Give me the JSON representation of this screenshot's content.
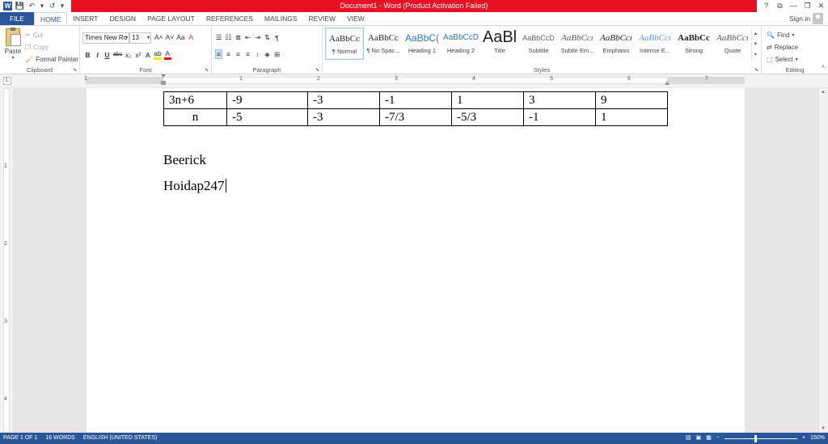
{
  "window": {
    "title": "Document1 -  Word (Product Activation Failed)",
    "controls": {
      "help": "?",
      "ribbon_options": "⧉",
      "minimize": "—",
      "restore": "❐",
      "close": "✕"
    }
  },
  "qat": {
    "logo": "W",
    "save": "💾",
    "undo": "↶",
    "undo_arrow": "▾",
    "redo": "↺",
    "more": "▾"
  },
  "tabs": [
    {
      "label": "FILE"
    },
    {
      "label": "HOME"
    },
    {
      "label": "INSERT"
    },
    {
      "label": "DESIGN"
    },
    {
      "label": "PAGE LAYOUT"
    },
    {
      "label": "REFERENCES"
    },
    {
      "label": "MAILINGS"
    },
    {
      "label": "REVIEW"
    },
    {
      "label": "VIEW"
    }
  ],
  "signin": {
    "label": "Sign in"
  },
  "clipboard": {
    "group_label": "Clipboard",
    "paste_label": "Paste",
    "cut_label": "Cut",
    "copy_label": "Copy",
    "format_painter_label": "Format Painter"
  },
  "font": {
    "group_label": "Font",
    "font_name": "Times New Ro",
    "font_size": "13",
    "grow": "A˄",
    "shrink": "A˅",
    "change_case": "Aa",
    "clear": "A",
    "bold": "B",
    "italic": "I",
    "underline": "U",
    "strike": "abc",
    "subscript": "x₂",
    "superscript": "x²",
    "effects": "A",
    "highlight": "ab",
    "font_color": "A"
  },
  "paragraph": {
    "group_label": "Paragraph"
  },
  "styles": {
    "group_label": "Styles",
    "items": [
      {
        "preview": "AaBbCc",
        "name": "¶ Normal"
      },
      {
        "preview": "AaBbCc",
        "name": "¶ No Spac..."
      },
      {
        "preview": "AaBbC(",
        "name": "Heading 1"
      },
      {
        "preview": "AaBbCcD",
        "name": "Heading 2"
      },
      {
        "preview": "AaBl",
        "name": "Title"
      },
      {
        "preview": "AaBbCcD",
        "name": "Subtitle"
      },
      {
        "preview": "AaBbCcı",
        "name": "Subtle Em..."
      },
      {
        "preview": "AaBbCcı",
        "name": "Emphasis"
      },
      {
        "preview": "AaBbCcı",
        "name": "Intense E..."
      },
      {
        "preview": "AaBbCc",
        "name": "Strong"
      },
      {
        "preview": "AaBbCcı",
        "name": "Quote"
      }
    ]
  },
  "editing": {
    "group_label": "Editing",
    "find_label": "Find",
    "replace_label": "Replace",
    "select_label": "Select"
  },
  "ruler": {
    "numbers": [
      "1",
      "1",
      "2",
      "3",
      "4",
      "5",
      "6",
      "7"
    ],
    "vertical": [
      "1",
      "2",
      "3",
      "4"
    ]
  },
  "document": {
    "table": [
      [
        "3n+6",
        "-9",
        "-3",
        "-1",
        "1",
        "3",
        "9"
      ],
      [
        "n",
        "-5",
        "-3",
        "-7/3",
        "-5/3",
        "-1",
        "1"
      ]
    ],
    "para1": "Beerick",
    "para2": "Hoidap247"
  },
  "statusbar": {
    "page": "PAGE 1 OF 1",
    "words": "16 WORDS",
    "language": "ENGLISH (UNITED STATES)",
    "zoom_minus": "−",
    "zoom_plus": "+",
    "zoom": "150%"
  }
}
